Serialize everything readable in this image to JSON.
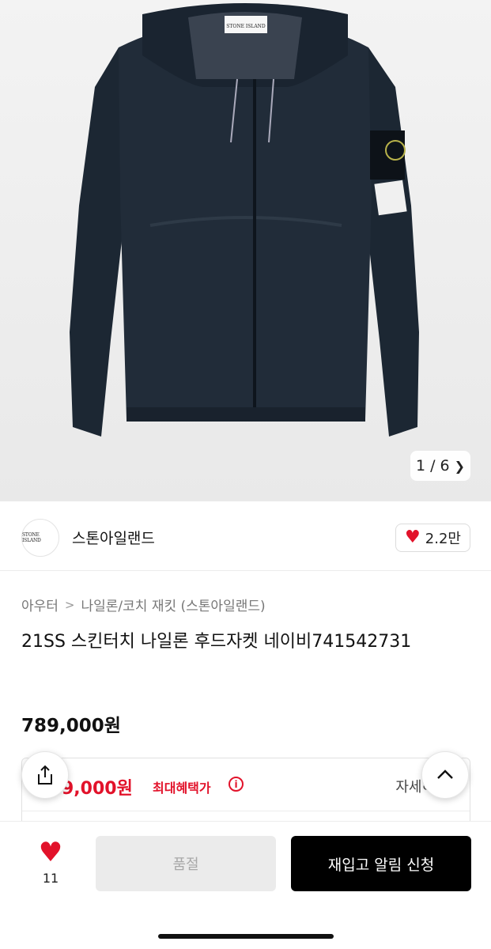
{
  "gallery": {
    "image_alt": "Stone Island navy hooded nylon jacket",
    "counter_current": "1",
    "counter_sep": "/",
    "counter_total": "6",
    "tag_text": "STONE ISLAND"
  },
  "brand": {
    "logo_text": "STONE ISLAND",
    "name": "스톤아일랜드",
    "likes": "2.2만"
  },
  "breadcrumb": {
    "category": "아우터",
    "subcategory": "나일론/코치 재킷 (스톤아일랜드)"
  },
  "product": {
    "title": "21SS 스킨터치 나일론 후드자켓 네이비741542731",
    "price": "789,000원"
  },
  "benefit": {
    "price": "9,000원",
    "label": "최대혜택가",
    "info": "i",
    "detail": "자세히"
  },
  "bottom": {
    "wish_count": "11",
    "soldout_label": "품절",
    "restock_label": "재입고 알림 신청"
  },
  "colors": {
    "accent_red": "#e2122a",
    "jacket_navy": "#1c2733",
    "cta_black": "#000000"
  }
}
